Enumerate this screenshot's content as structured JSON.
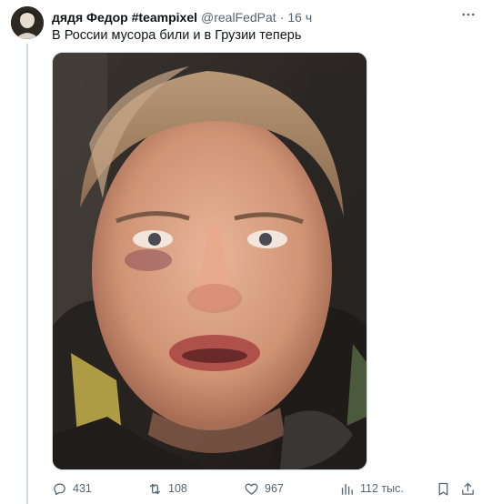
{
  "tweet": {
    "display_name": "дядя Федор #teampixel",
    "handle": "@realFedPat",
    "separator": "·",
    "time": "16 ч",
    "text": "В России мусора били и в Грузии теперь"
  },
  "icons": {
    "more": "more-horizontal-icon",
    "reply": "reply-icon",
    "retweet": "retweet-icon",
    "like": "heart-icon",
    "views": "views-icon",
    "bookmark": "bookmark-icon",
    "share": "share-icon"
  },
  "actions": {
    "reply_count": "431",
    "retweet_count": "108",
    "like_count": "967",
    "views_count": "112 тыс."
  },
  "colors": {
    "text_primary": "#0f1419",
    "text_secondary": "#536471",
    "thread_line": "#cfd9de"
  }
}
